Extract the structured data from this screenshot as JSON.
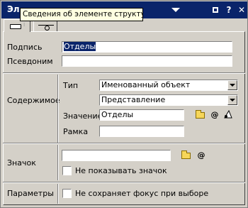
{
  "window": {
    "title": "Эл"
  },
  "tooltip": {
    "text": "Сведения об элементе структуры"
  },
  "titlebar": {
    "help_label": "?",
    "close_label": "✕"
  },
  "caption": {
    "label": "Подпись",
    "value": "Отделы"
  },
  "alias": {
    "label": "Псевдоним",
    "value": ""
  },
  "content": {
    "section_label": "Содержимое",
    "type_label": "Тип",
    "type_value": "Именованный объект",
    "kind_value": "Представление",
    "value_label": "Значение",
    "value_value": "Отделы",
    "at_label": "@",
    "frame_label": "Рамка",
    "frame_value": ""
  },
  "icon": {
    "section_label": "Значок",
    "value": "",
    "at_label": "@",
    "hide_checkbox_label": "Не показывать значок"
  },
  "params": {
    "section_label": "Параметры",
    "focus_checkbox_label": "Не сохраняет фокус при выборе"
  },
  "colors": {
    "titlebar": "#0a246a",
    "face": "#d4d0c8",
    "tooltip": "#ffffe1",
    "selection": "#0a246a"
  }
}
